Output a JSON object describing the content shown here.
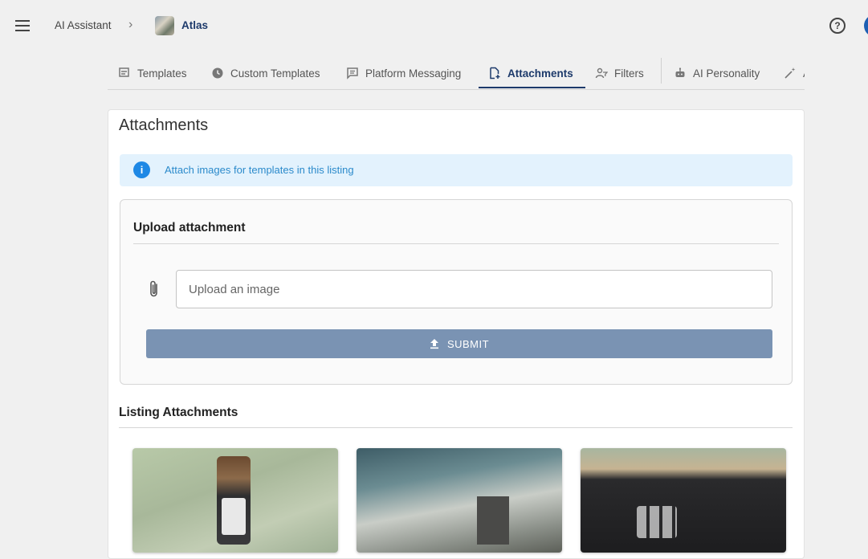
{
  "breadcrumb": {
    "root": "AI Assistant",
    "current": "Atlas"
  },
  "header": {
    "help_glyph": "?"
  },
  "tabs": [
    {
      "label": "Templates",
      "icon": "templates-icon",
      "active": false
    },
    {
      "label": "Custom Templates",
      "icon": "clock-icon",
      "active": false
    },
    {
      "label": "Platform Messaging",
      "icon": "message-icon",
      "active": false
    },
    {
      "label": "Attachments",
      "icon": "file-attach-icon",
      "active": true
    },
    {
      "label": "Filters",
      "icon": "filter-user-icon",
      "active": false
    },
    {
      "label": "AI Personality",
      "icon": "robot-icon",
      "active": false
    },
    {
      "label": "A",
      "icon": "magic-wand-icon",
      "active": false
    }
  ],
  "page": {
    "title": "Attachments",
    "info": "Attach images for templates in this listing"
  },
  "upload": {
    "title": "Upload attachment",
    "placeholder": "Upload an image",
    "submit_label": "SUBMIT"
  },
  "listing": {
    "title": "Listing Attachments"
  },
  "colors": {
    "accent": "#1d3a6b",
    "info_bg": "#e3f2fd",
    "info_text": "#2b8acb",
    "submit_bg": "#7a93b3"
  }
}
